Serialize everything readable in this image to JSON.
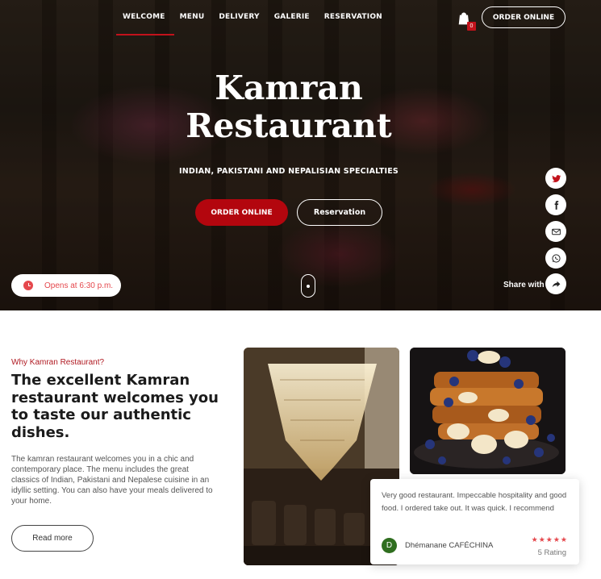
{
  "nav": {
    "items": [
      "WELCOME",
      "MENU",
      "DELIVERY",
      "GALERIE",
      "RESERVATION"
    ],
    "active": "WELCOME",
    "cart_count": "0",
    "order_button": "ORDER ONLINE"
  },
  "hero": {
    "title_line1": "Kamran",
    "title_line2": "Restaurant",
    "subtitle": "INDIAN, PAKISTANI AND NEPALISIAN SPECIALTIES",
    "order_button": "ORDER ONLINE",
    "reservation_button": "Reservation",
    "opening": "Opens at 6:30 p.m.",
    "share_label": "Share with"
  },
  "social": [
    "twitter-icon",
    "facebook-icon",
    "mail-icon",
    "whatsapp-icon",
    "share-icon"
  ],
  "about": {
    "eyebrow": "Why Kamran Restaurant?",
    "title": "The excellent Kamran restaurant welcomes you to taste our authentic dishes.",
    "text": "The kamran restaurant welcomes you in a chic and contemporary place. The menu includes the great classics of Indian, Pakistani and Nepalese cuisine in an idyllic setting. You can also have your meals delivered to your home.",
    "read_more": "Read more"
  },
  "review": {
    "text": "Very good restaurant. Impeccable hospitality and good food. I ordered take out. It was quick. I recommend",
    "avatar_letter": "D",
    "author": "Dhémanane CAFÉCHINA",
    "stars": "★★★★★",
    "rating": "5 Rating"
  },
  "colors": {
    "accent": "#b3060e",
    "star": "#e5484d",
    "avatar": "#2f6e1f"
  }
}
